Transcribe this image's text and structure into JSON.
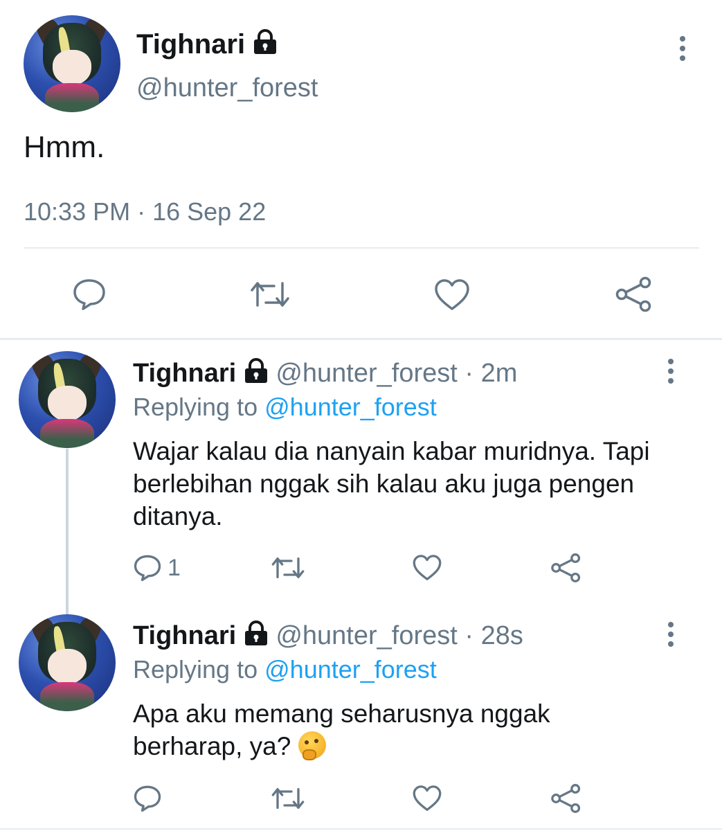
{
  "main_tweet": {
    "name": "Tighnari",
    "handle": "@hunter_forest",
    "text": "Hmm.",
    "timestamp": "10:33 PM · 16 Sep 22"
  },
  "replies": [
    {
      "name": "Tighnari",
      "handle": "@hunter_forest",
      "time": "· 2m",
      "replying_prefix": "Replying to",
      "replying_to": "@hunter_forest",
      "text": "Wajar kalau dia nanyain kabar muridnya. Tapi berlebihan nggak sih kalau aku juga pengen ditanya.",
      "reply_count": "1"
    },
    {
      "name": "Tighnari",
      "handle": "@hunter_forest",
      "time": "· 28s",
      "replying_prefix": "Replying to",
      "replying_to": "@hunter_forest",
      "text": "Apa aku memang seharusnya nggak berharap, ya?",
      "emoji": "thinking-face",
      "reply_count": ""
    }
  ],
  "colors": {
    "text": "#14171a",
    "secondary": "#657786",
    "link": "#1da1f2",
    "divider": "#e6ecf0"
  },
  "icons": [
    "lock-icon",
    "more-icon",
    "reply-icon",
    "retweet-icon",
    "like-icon",
    "share-icon",
    "thinking-face-emoji"
  ]
}
